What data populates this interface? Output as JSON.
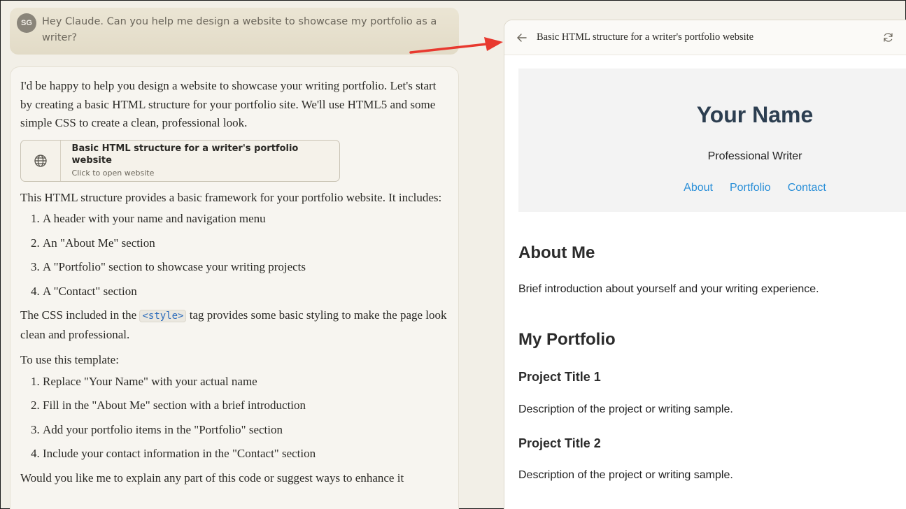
{
  "user_message": {
    "avatar_initials": "SG",
    "text": "Hey Claude. Can you help me design a website to showcase my portfolio as a writer?"
  },
  "assistant": {
    "intro": "I'd be happy to help you design a website to showcase your writing portfolio. Let's start by creating a basic HTML structure for your portfolio site. We'll use HTML5 and some simple CSS to create a clean, professional look.",
    "artifact_card": {
      "icon": "globe-icon",
      "title": "Basic HTML structure for a writer's portfolio website",
      "subtitle": "Click to open website"
    },
    "structure_intro": "This HTML structure provides a basic framework for your portfolio website. It includes:",
    "structure_items": [
      "A header with your name and navigation menu",
      "An \"About Me\" section",
      "A \"Portfolio\" section to showcase your writing projects",
      "A \"Contact\" section"
    ],
    "css_note_before": "The CSS included in the ",
    "css_note_code": "<style>",
    "css_note_after": " tag provides some basic styling to make the page look clean and professional.",
    "usage_intro": "To use this template:",
    "usage_items": [
      "Replace \"Your Name\" with your actual name",
      "Fill in the \"About Me\" section with a brief introduction",
      "Add your portfolio items in the \"Portfolio\" section",
      "Include your contact information in the \"Contact\" section"
    ],
    "closing": "Would you like me to explain any part of this code or suggest ways to enhance it"
  },
  "panel": {
    "title": "Basic HTML structure for a writer's portfolio website",
    "back_icon": "arrow-left-icon",
    "refresh_icon": "refresh-icon"
  },
  "preview": {
    "name": "Your Name",
    "tagline": "Professional Writer",
    "nav": [
      "About",
      "Portfolio",
      "Contact"
    ],
    "about_heading": "About Me",
    "about_text": "Brief introduction about yourself and your writing experience.",
    "portfolio_heading": "My Portfolio",
    "projects": [
      {
        "title": "Project Title 1",
        "description": "Description of the project or writing sample."
      },
      {
        "title": "Project Title 2",
        "description": "Description of the project or writing sample."
      }
    ]
  },
  "colors": {
    "page_bg": "#f2efe7",
    "arrow": "#e8392f",
    "site_title": "#2c3e50",
    "site_link": "#2a8fd8"
  }
}
